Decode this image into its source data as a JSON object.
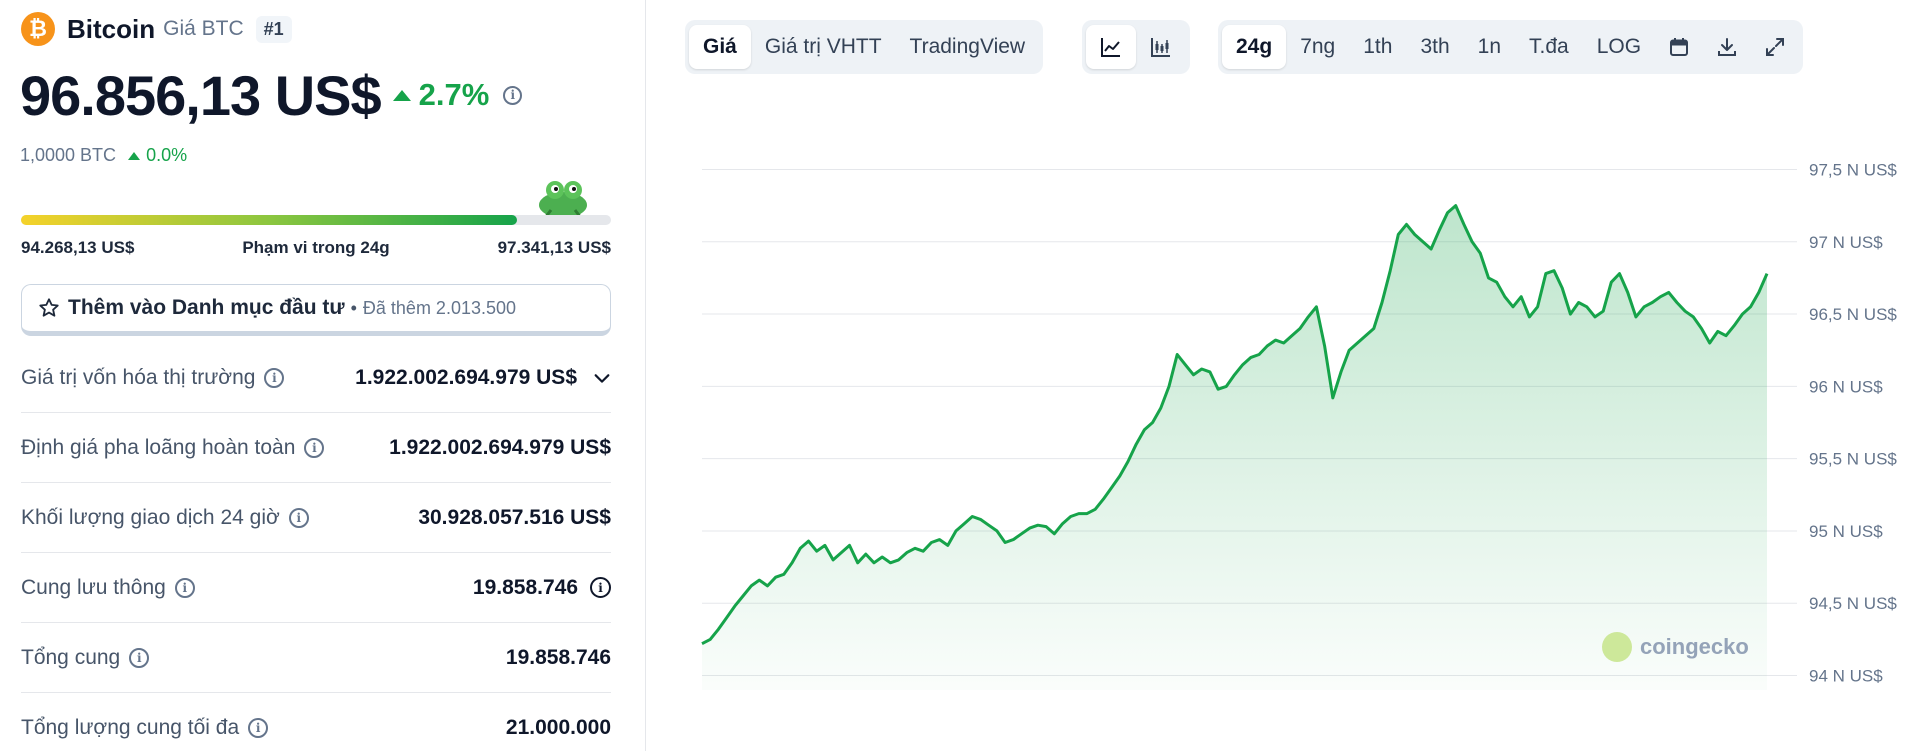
{
  "coin": {
    "logo_symbol": "₿",
    "name": "Bitcoin",
    "subtitle": "Giá BTC",
    "rank": "#1",
    "price": "96.856,13 US$",
    "change_pct": "2.7%",
    "btc_amount": "1,0000 BTC",
    "btc_change": "0.0%"
  },
  "range": {
    "low": "94.268,13 US$",
    "label": "Phạm vi trong 24g",
    "high": "97.341,13 US$",
    "fill_fraction": 0.84
  },
  "watchlist": {
    "label": "Thêm vào Danh mục đầu tư",
    "dot": "•",
    "added": "Đã thêm 2.013.500"
  },
  "stats": [
    {
      "label": "Giá trị vốn hóa thị trường",
      "value": "1.922.002.694.979 US$",
      "expand": true
    },
    {
      "label": "Định giá pha loãng hoàn toàn",
      "value": "1.922.002.694.979 US$"
    },
    {
      "label": "Khối lượng giao dịch 24 giờ",
      "value": "30.928.057.516 US$"
    },
    {
      "label": "Cung lưu thông",
      "value": "19.858.746",
      "value_info": true
    },
    {
      "label": "Tổng cung",
      "value": "19.858.746"
    },
    {
      "label": "Tổng lượng cung tối đa",
      "value": "21.000.000"
    }
  ],
  "tabs": {
    "view": [
      "Giá",
      "Giá trị VHTT",
      "TradingView"
    ],
    "view_active": 0,
    "chart_type_icons": [
      "line-chart-icon",
      "candlestick-icon"
    ],
    "periods": [
      "24g",
      "7ng",
      "1th",
      "3th",
      "1n",
      "T.đa",
      "LOG"
    ],
    "period_active": 0,
    "tool_icons": [
      "calendar-icon",
      "download-icon",
      "fullscreen-icon"
    ]
  },
  "watermark": "coingecko",
  "colors": {
    "accent_green": "#16a34a",
    "btc_orange": "#f7931a"
  },
  "chart_data": {
    "type": "area",
    "title": "",
    "xlabel": "",
    "ylabel": "",
    "ylim": [
      93.9,
      97.6
    ],
    "y_ticks": [
      {
        "value": 97.5,
        "label": "97,5 N US$"
      },
      {
        "value": 97.0,
        "label": "97 N US$"
      },
      {
        "value": 96.5,
        "label": "96,5 N US$"
      },
      {
        "value": 96.0,
        "label": "96 N US$"
      },
      {
        "value": 95.5,
        "label": "95,5 N US$"
      },
      {
        "value": 95.0,
        "label": "95 N US$"
      },
      {
        "value": 94.5,
        "label": "94,5 N US$"
      },
      {
        "value": 94.0,
        "label": "94 N US$"
      }
    ],
    "grid": true,
    "series": [
      {
        "values": [
          94.22,
          94.25,
          94.32,
          94.4,
          94.48,
          94.55,
          94.62,
          94.66,
          94.62,
          94.68,
          94.7,
          94.78,
          94.88,
          94.93,
          94.86,
          94.9,
          94.8,
          94.85,
          94.9,
          94.78,
          94.84,
          94.78,
          94.82,
          94.78,
          94.8,
          94.85,
          94.88,
          94.86,
          94.92,
          94.94,
          94.9,
          95.0,
          95.05,
          95.1,
          95.08,
          95.04,
          95.0,
          94.92,
          94.94,
          94.98,
          95.02,
          95.04,
          95.03,
          94.98,
          95.05,
          95.1,
          95.12,
          95.12,
          95.15,
          95.22,
          95.3,
          95.38,
          95.48,
          95.6,
          95.7,
          95.75,
          95.85,
          96.0,
          96.22,
          96.15,
          96.08,
          96.12,
          96.1,
          95.98,
          96.0,
          96.08,
          96.15,
          96.2,
          96.22,
          96.28,
          96.32,
          96.3,
          96.35,
          96.4,
          96.48,
          96.55,
          96.28,
          95.92,
          96.1,
          96.25,
          96.3,
          96.35,
          96.4,
          96.58,
          96.8,
          97.05,
          97.12,
          97.05,
          97.0,
          96.95,
          97.08,
          97.2,
          97.25,
          97.12,
          97.0,
          96.92,
          96.75,
          96.72,
          96.62,
          96.55,
          96.62,
          96.48,
          96.55,
          96.78,
          96.8,
          96.68,
          96.5,
          96.58,
          96.55,
          96.48,
          96.52,
          96.72,
          96.78,
          96.65,
          96.48,
          96.55,
          96.58,
          96.62,
          96.65,
          96.58,
          96.52,
          96.48,
          96.4,
          96.3,
          96.38,
          96.35,
          96.42,
          96.5,
          96.55,
          96.65,
          96.78
        ]
      }
    ]
  }
}
